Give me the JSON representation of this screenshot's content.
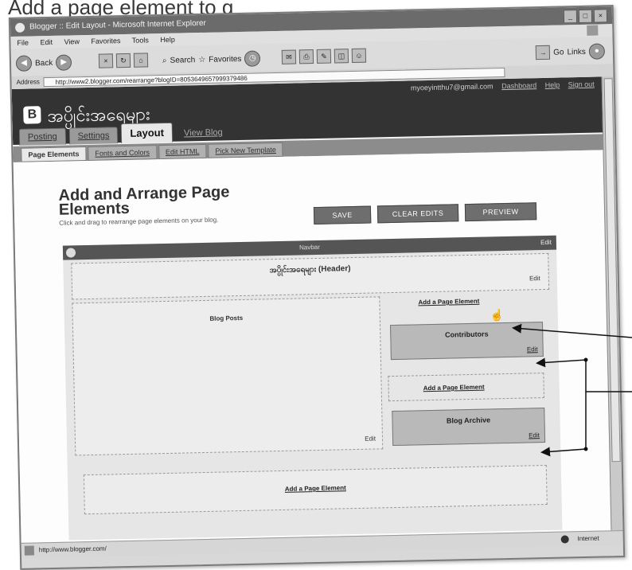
{
  "caption": "Add a page element to g",
  "browser": {
    "title": "Blogger :: Edit Layout - Microsoft Internet Explorer",
    "menu": [
      "File",
      "Edit",
      "View",
      "Favorites",
      "Tools",
      "Help"
    ],
    "toolbar": {
      "back": "Back",
      "search": "Search",
      "favorites": "Favorites",
      "go": "Go",
      "links": "Links"
    },
    "address_label": "Address",
    "address_url": "http://www2.blogger.com/rearrange?blogID=8053649657999379486",
    "status_url": "http://www.blogger.com/",
    "status_zone": "Internet"
  },
  "blog": {
    "logo": "B",
    "title": "အပ္ပိုင်းအရေများ",
    "user_email": "myoeyintthu7@gmail.com",
    "links": [
      "Dashboard",
      "Help",
      "Sign out"
    ],
    "tabs": [
      "Posting",
      "Settings",
      "Layout",
      "View Blog"
    ],
    "subtabs": [
      "Page Elements",
      "Fonts and Colors",
      "Edit HTML",
      "Pick New Template"
    ]
  },
  "page": {
    "title": "Add and Arrange Page Elements",
    "description": "Click and drag to rearrange page elements on your blog.",
    "buttons": {
      "save": "SAVE",
      "clear": "CLEAR EDITS",
      "preview": "PREVIEW"
    }
  },
  "layout": {
    "navbar": "Navbar",
    "navbar_edit": "Edit",
    "header": "အပ္ပိုင်းအရေများ (Header)",
    "header_edit": "Edit",
    "blog_posts": "Blog Posts",
    "main_edit": "Edit",
    "add_element": "Add a Page Element",
    "widgets": [
      {
        "title": "Contributors",
        "edit": "Edit"
      },
      {
        "title": "Blog Archive",
        "edit": "Edit"
      }
    ]
  }
}
